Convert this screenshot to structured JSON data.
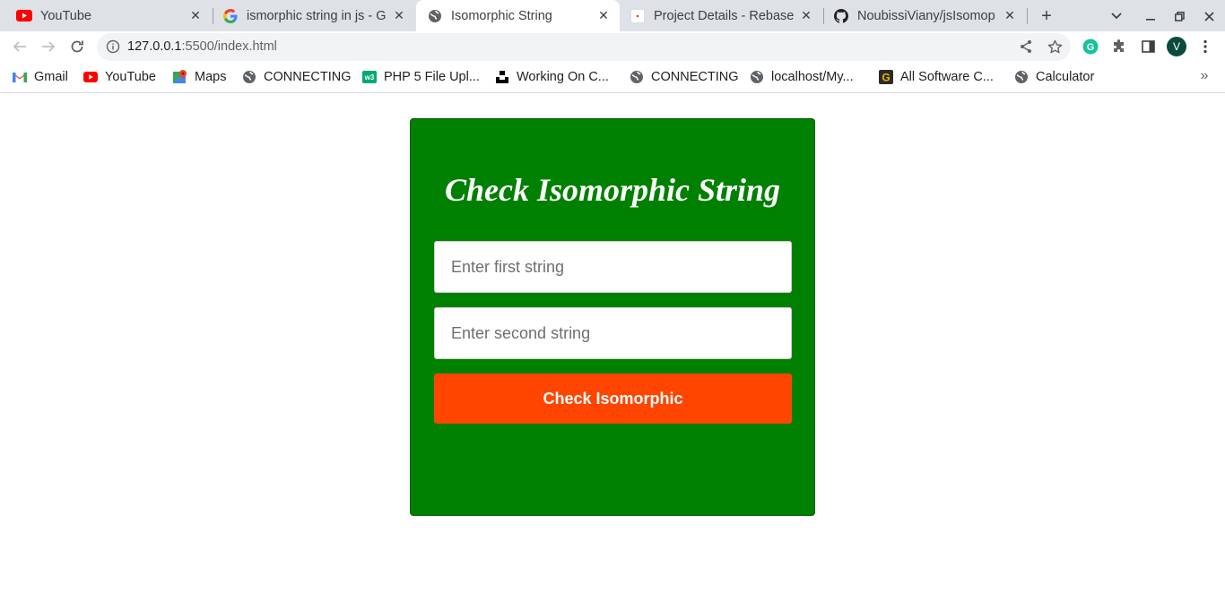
{
  "tabs": [
    {
      "title": "YouTube",
      "icon": "youtube-icon",
      "active": false
    },
    {
      "title": "ismorphic string in js - G",
      "icon": "google-icon",
      "active": false
    },
    {
      "title": "Isomorphic String",
      "icon": "globe-icon",
      "active": true
    },
    {
      "title": "Project Details - Rebase",
      "icon": "rebase-icon",
      "active": false
    },
    {
      "title": "NoubissiViany/jsIsomop",
      "icon": "github-icon",
      "active": false
    }
  ],
  "address_bar": {
    "host": "127.0.0.1",
    "path": ":5500/index.html"
  },
  "profile": {
    "initial": "V"
  },
  "bookmarks": [
    {
      "label": "Gmail",
      "icon": "gmail-icon"
    },
    {
      "label": "YouTube",
      "icon": "youtube-icon"
    },
    {
      "label": "Maps",
      "icon": "maps-icon"
    },
    {
      "label": "CONNECTING",
      "icon": "globe-icon"
    },
    {
      "label": "PHP 5 File Upl...",
      "icon": "w3schools-icon"
    },
    {
      "label": "Working On C...",
      "icon": "unsplash-icon"
    },
    {
      "label": "CONNECTING",
      "icon": "globe-icon"
    },
    {
      "label": "localhost/My...",
      "icon": "globe-icon"
    },
    {
      "label": "All Software C...",
      "icon": "g-logo-icon"
    },
    {
      "label": "Calculator",
      "icon": "globe-icon"
    }
  ],
  "page": {
    "heading": "Check Isomorphic String",
    "first_input_placeholder": "Enter first string",
    "first_input_value": "",
    "second_input_placeholder": "Enter second string",
    "second_input_value": "",
    "button_label": "Check Isomorphic",
    "colors": {
      "card": "#008000",
      "button": "#ff4500"
    }
  }
}
